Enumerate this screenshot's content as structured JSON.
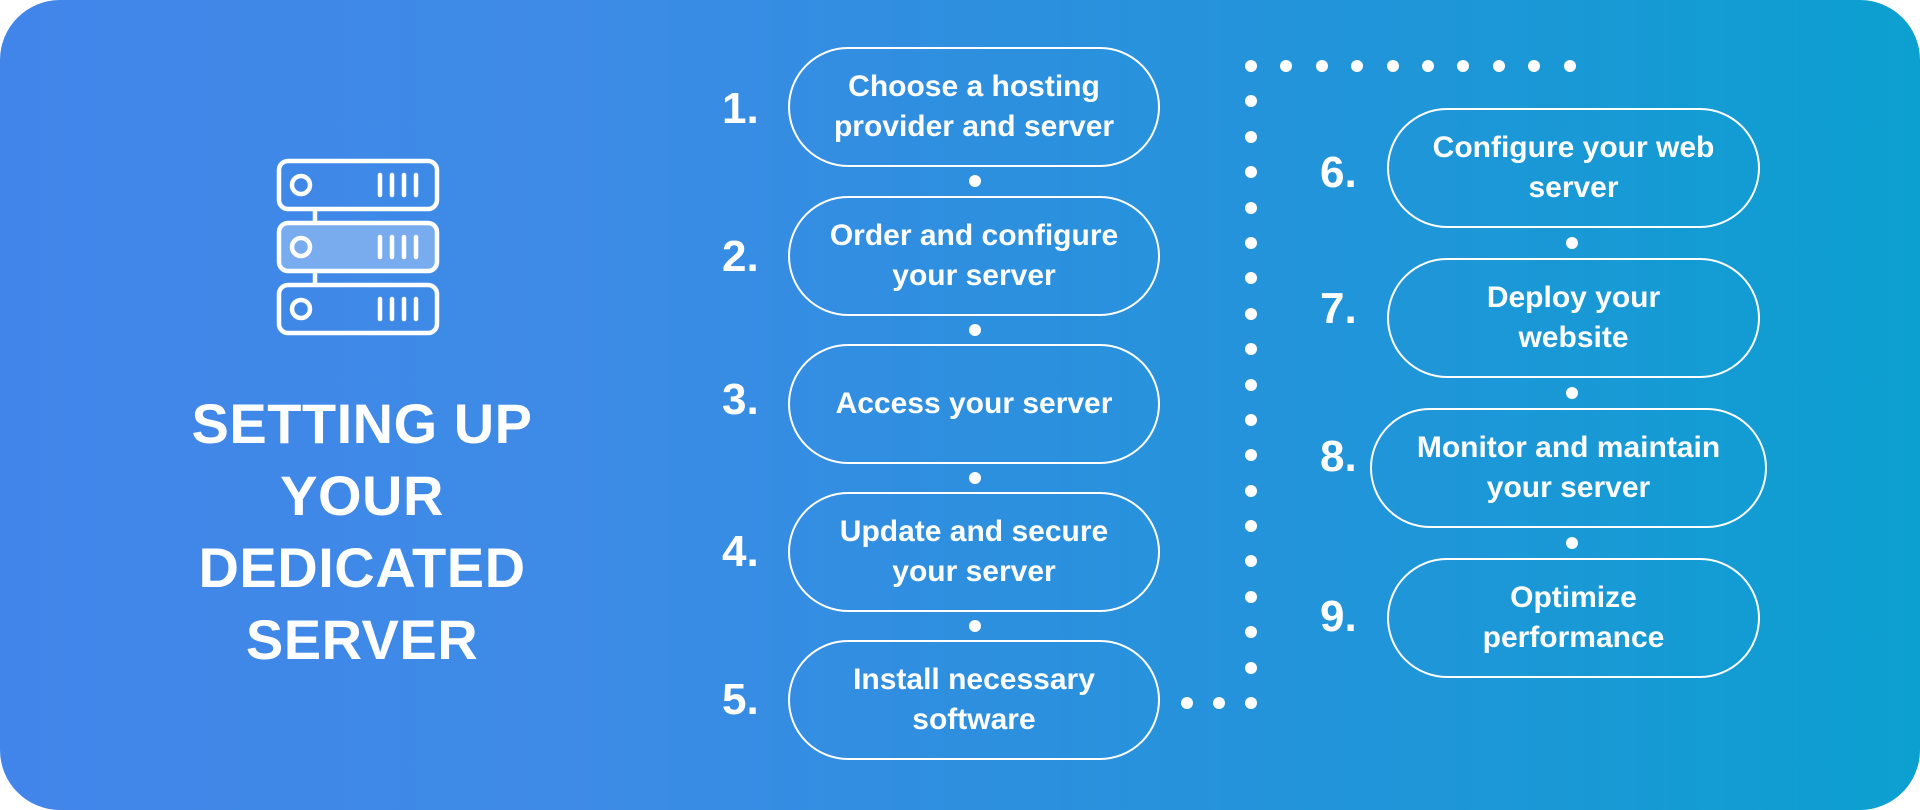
{
  "title": {
    "lines": [
      "SETTING UP",
      "YOUR",
      "DEDICATED",
      "SERVER"
    ]
  },
  "icon": "server-rack-icon",
  "colors": {
    "gradient_start": "#4285EA",
    "gradient_end": "#0CA0D0",
    "foreground": "#FFFFFF"
  },
  "steps": [
    {
      "number": "1.",
      "label": "Choose a hosting\nprovider and server"
    },
    {
      "number": "2.",
      "label": "Order and configure\nyour server"
    },
    {
      "number": "3.",
      "label": "Access your server"
    },
    {
      "number": "4.",
      "label": "Update and secure\nyour server"
    },
    {
      "number": "5.",
      "label": "Install necessary\nsoftware"
    },
    {
      "number": "6.",
      "label": "Configure your web\nserver"
    },
    {
      "number": "7.",
      "label": "Deploy your\nwebsite"
    },
    {
      "number": "8.",
      "label": "Monitor and maintain\nyour server"
    },
    {
      "number": "9.",
      "label": "Optimize\nperformance"
    }
  ]
}
